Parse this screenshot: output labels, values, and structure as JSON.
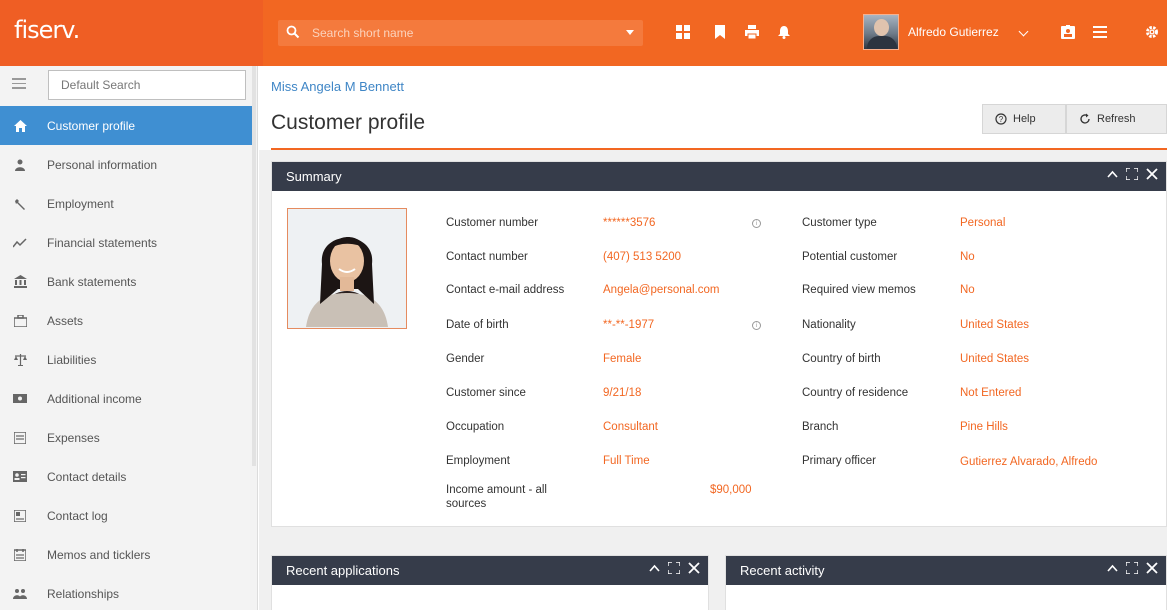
{
  "brand": {
    "logo": "fiserv."
  },
  "topbar": {
    "search_placeholder": "Search short name",
    "icons": [
      "dashboard-icon",
      "bookmark-icon",
      "print-icon",
      "bell-icon",
      "id-card-icon",
      "list-icon",
      "gear-icon"
    ],
    "user_name": "Alfredo Gutierrez"
  },
  "sidebar": {
    "search_value": "Default Search",
    "items": [
      {
        "label": "Customer profile",
        "icon": "home-icon",
        "active": true
      },
      {
        "label": "Personal information",
        "icon": "person-icon"
      },
      {
        "label": "Employment",
        "icon": "wrench-icon"
      },
      {
        "label": "Financial statements",
        "icon": "trend-icon"
      },
      {
        "label": "Bank statements",
        "icon": "bank-icon"
      },
      {
        "label": "Assets",
        "icon": "briefcase-icon"
      },
      {
        "label": "Liabilities",
        "icon": "scale-icon"
      },
      {
        "label": "Additional income",
        "icon": "cash-icon"
      },
      {
        "label": "Expenses",
        "icon": "receipt-icon"
      },
      {
        "label": "Contact details",
        "icon": "contact-card-icon"
      },
      {
        "label": "Contact log",
        "icon": "log-icon"
      },
      {
        "label": "Memos and ticklers",
        "icon": "calendar-icon"
      },
      {
        "label": "Relationships",
        "icon": "people-icon"
      }
    ]
  },
  "header": {
    "breadcrumb": "Miss Angela M Bennett",
    "title": "Customer profile",
    "help_label": "Help",
    "refresh_label": "Refresh"
  },
  "summary": {
    "title": "Summary",
    "left_fields": [
      {
        "label": "Customer number",
        "value": "******3576"
      },
      {
        "label": "Contact number",
        "value": "(407) 513 5200"
      },
      {
        "label": "Contact e-mail address",
        "value": "Angela@personal.com"
      },
      {
        "label": "Date of birth",
        "value": "**-**-1977"
      },
      {
        "label": "Gender",
        "value": "Female"
      },
      {
        "label": "Customer since",
        "value": "9/21/18"
      },
      {
        "label": "Occupation",
        "value": "Consultant"
      },
      {
        "label": "Employment",
        "value": "Full Time"
      },
      {
        "label": "Income amount - all sources",
        "value": "$90,000"
      }
    ],
    "right_fields": [
      {
        "label": "Customer type",
        "value": "Personal"
      },
      {
        "label": "Potential customer",
        "value": "No"
      },
      {
        "label": "Required view memos",
        "value": "No"
      },
      {
        "label": "Nationality",
        "value": "United States"
      },
      {
        "label": "Country of birth",
        "value": "United States"
      },
      {
        "label": "Country of residence",
        "value": "Not Entered"
      },
      {
        "label": "Branch",
        "value": "Pine Hills"
      },
      {
        "label": "Primary officer",
        "value": "Gutierrez Alvarado, Alfredo"
      }
    ]
  },
  "panels": {
    "recent_applications": "Recent applications",
    "recent_activity": "Recent activity"
  },
  "colors": {
    "brand_orange": "#f26722",
    "active_blue": "#3f8fd2",
    "panel_header": "#363c4a"
  }
}
